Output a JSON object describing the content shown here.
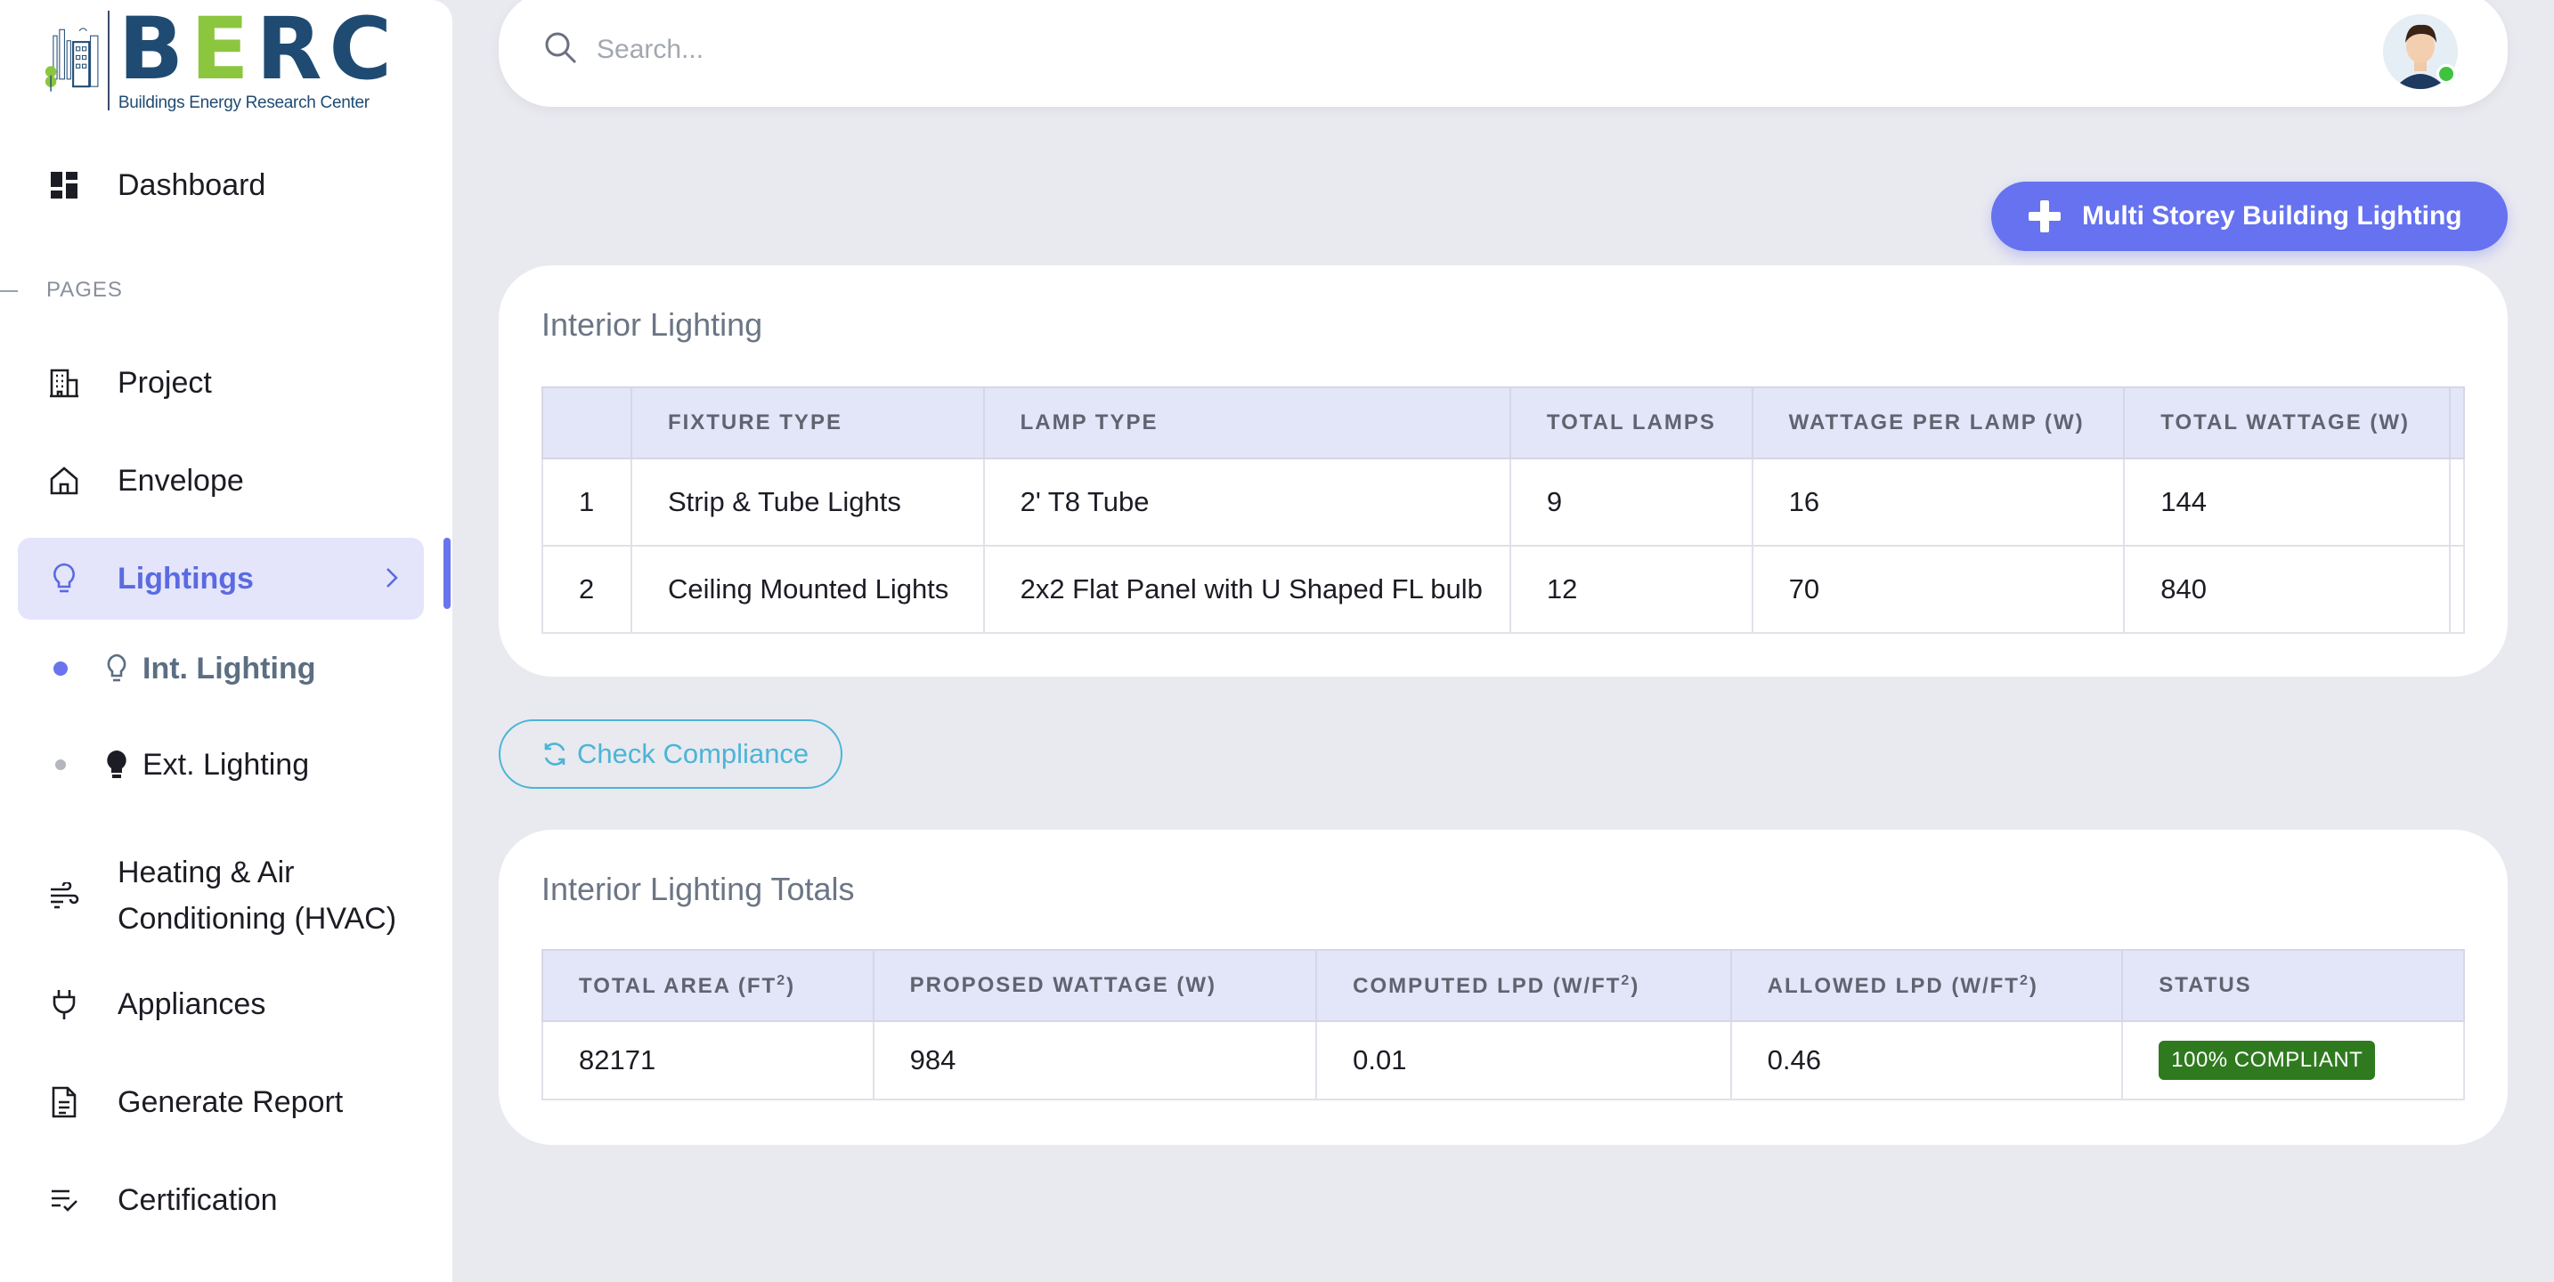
{
  "brand": {
    "name_part1": "B",
    "name_part2": "E",
    "name_part3": "RC",
    "subtitle": "Buildings Energy Research Center"
  },
  "search": {
    "placeholder": "Search..."
  },
  "sidebar": {
    "section_label": "PAGES",
    "items": [
      {
        "label": "Dashboard",
        "icon": "dashboard-icon"
      },
      {
        "label": "Project",
        "icon": "building-icon"
      },
      {
        "label": "Envelope",
        "icon": "home-icon"
      },
      {
        "label": "Lightings",
        "icon": "lightbulb-icon",
        "active": true
      },
      {
        "label": "Heating & Air Conditioning (HVAC)",
        "icon": "wind-icon"
      },
      {
        "label": "Appliances",
        "icon": "plug-icon"
      },
      {
        "label": "Generate Report",
        "icon": "document-icon"
      },
      {
        "label": "Certification",
        "icon": "checklist-icon"
      }
    ],
    "hvac_line1": "Heating & Air",
    "hvac_line2": "Conditioning (HVAC)",
    "sub_items": [
      {
        "label": "Int. Lighting",
        "active": true
      },
      {
        "label": "Ext. Lighting",
        "active": false
      }
    ]
  },
  "toolbar": {
    "add_label": "Multi Storey Building Lighting"
  },
  "interior": {
    "title": "Interior Lighting",
    "columns": [
      "",
      "Fixture Type",
      "Lamp Type",
      "Total Lamps",
      "Wattage per Lamp (W)",
      "Total Wattage (W)"
    ],
    "rows": [
      {
        "index": "1",
        "fixture": "Strip & Tube Lights",
        "lamp": "2' T8 Tube",
        "total_lamps": "9",
        "wattage": "16",
        "total_wattage": "144"
      },
      {
        "index": "2",
        "fixture": "Ceiling Mounted Lights",
        "lamp": "2x2 Flat Panel with U Shaped FL bulb",
        "total_lamps": "12",
        "wattage": "70",
        "total_wattage": "840"
      }
    ]
  },
  "compliance": {
    "button_label": "Check Compliance"
  },
  "totals": {
    "title": "Interior Lighting Totals",
    "col_area": "Total Area (ft",
    "col_proposed": "Proposed Wattage (W)",
    "col_computed": "Computed LPD (w/ft",
    "col_allowed": "Allowed LPD (w/ft",
    "col_status": "Status",
    "sup": "2",
    "close": ")",
    "row": {
      "area": "82171",
      "proposed": "984",
      "computed": "0.01",
      "allowed": "0.46",
      "status": "100% COMPLIANT"
    }
  },
  "colors": {
    "accent": "#6672f0",
    "success": "#2f7a1f",
    "info": "#4bb5d6"
  }
}
